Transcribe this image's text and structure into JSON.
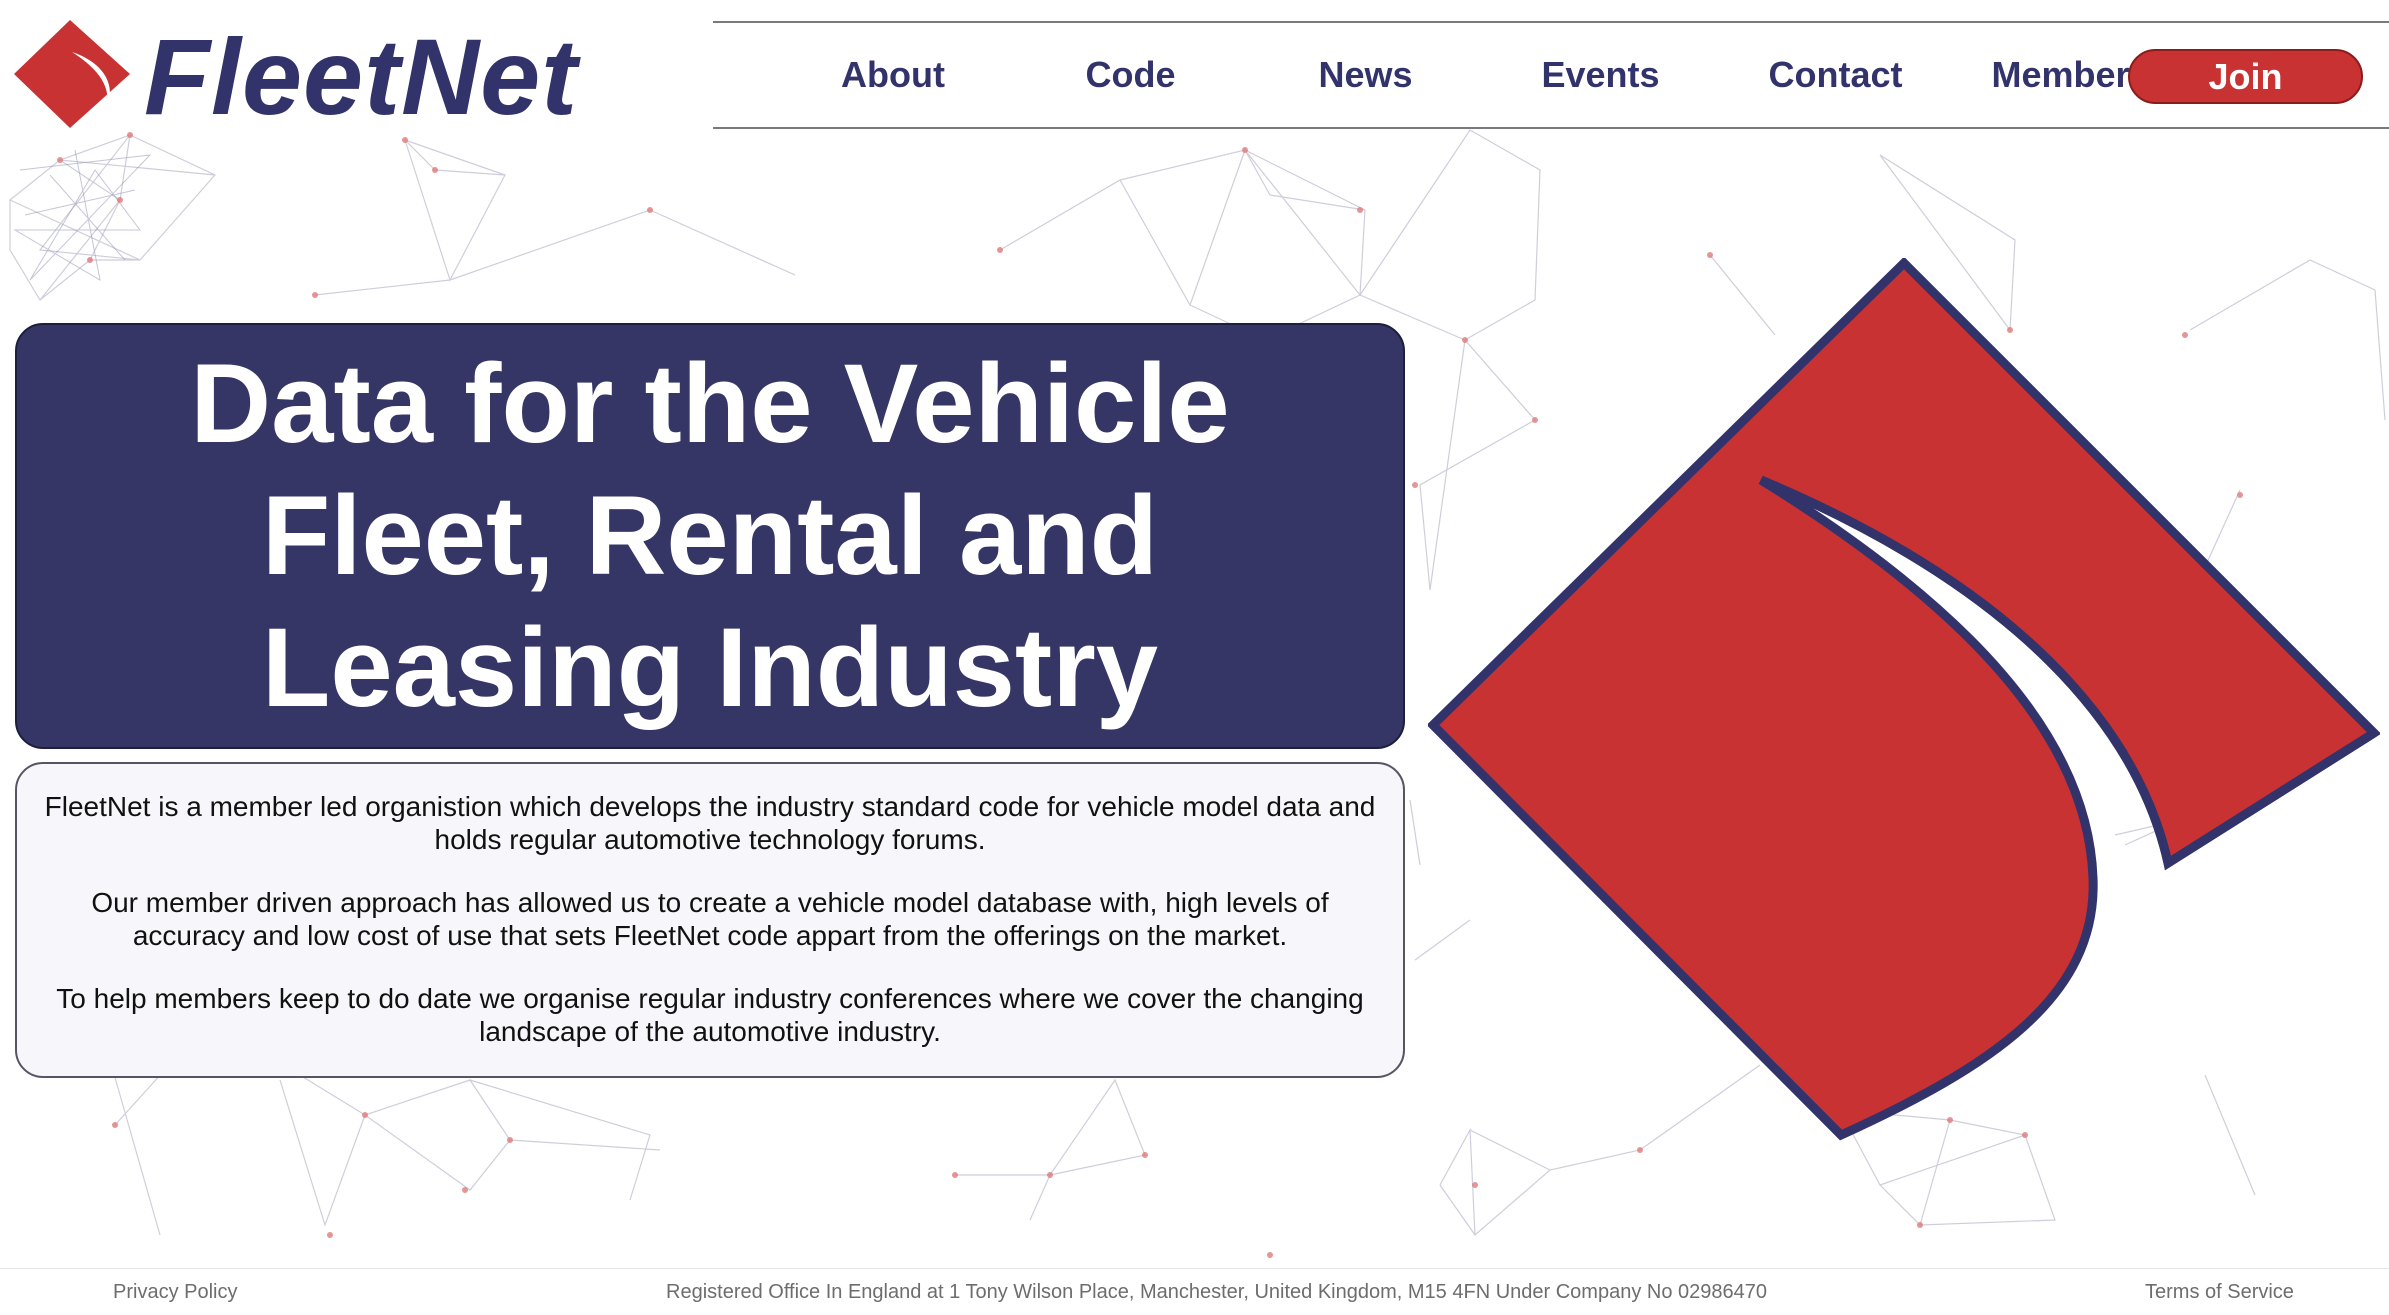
{
  "brand": {
    "name": "FleetNet",
    "colors": {
      "navy": "#33336b",
      "red": "#c83232",
      "hero_bg": "#353566"
    }
  },
  "nav": {
    "items": [
      {
        "label": "About"
      },
      {
        "label": "Code"
      },
      {
        "label": "News"
      },
      {
        "label": "Events"
      },
      {
        "label": "Contact"
      },
      {
        "label": "Members"
      }
    ],
    "join_label": "Join"
  },
  "hero": {
    "lines": [
      "Data for the Vehicle",
      "Fleet, Rental and",
      "Leasing Industry"
    ]
  },
  "intro": {
    "paragraphs": [
      "FleetNet is a member led organistion which develops the industry standard code for vehicle model data and holds regular automotive technology forums.",
      "Our member driven approach has allowed us to create a vehicle model database with, high levels of accuracy and low cost of use that sets FleetNet code appart from the offerings on the market.",
      "To help members keep to do date we organise regular industry conferences where we cover the changing landscape of the automotive industry."
    ]
  },
  "footer": {
    "privacy": "Privacy Policy",
    "registered": "Registered Office In England at 1 Tony Wilson Place, Manchester, United Kingdom, M15 4FN Under Company No 02986470",
    "terms": "Terms of Service"
  }
}
